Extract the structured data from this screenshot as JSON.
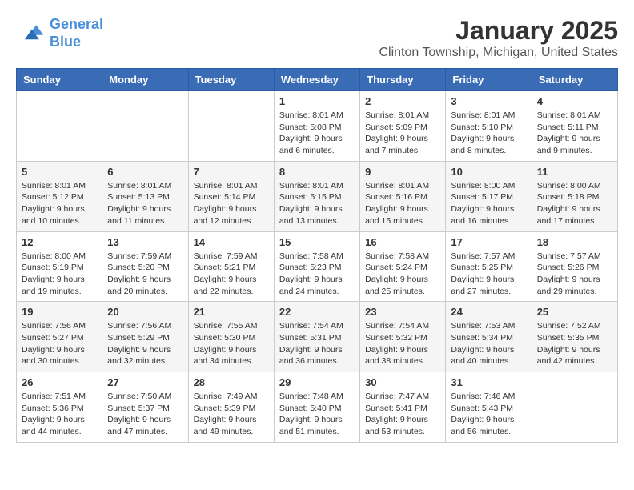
{
  "logo": {
    "line1": "General",
    "line2": "Blue"
  },
  "title": "January 2025",
  "location": "Clinton Township, Michigan, United States",
  "days_of_week": [
    "Sunday",
    "Monday",
    "Tuesday",
    "Wednesday",
    "Thursday",
    "Friday",
    "Saturday"
  ],
  "weeks": [
    [
      {
        "day": "",
        "info": ""
      },
      {
        "day": "",
        "info": ""
      },
      {
        "day": "",
        "info": ""
      },
      {
        "day": "1",
        "info": "Sunrise: 8:01 AM\nSunset: 5:08 PM\nDaylight: 9 hours\nand 6 minutes."
      },
      {
        "day": "2",
        "info": "Sunrise: 8:01 AM\nSunset: 5:09 PM\nDaylight: 9 hours\nand 7 minutes."
      },
      {
        "day": "3",
        "info": "Sunrise: 8:01 AM\nSunset: 5:10 PM\nDaylight: 9 hours\nand 8 minutes."
      },
      {
        "day": "4",
        "info": "Sunrise: 8:01 AM\nSunset: 5:11 PM\nDaylight: 9 hours\nand 9 minutes."
      }
    ],
    [
      {
        "day": "5",
        "info": "Sunrise: 8:01 AM\nSunset: 5:12 PM\nDaylight: 9 hours\nand 10 minutes."
      },
      {
        "day": "6",
        "info": "Sunrise: 8:01 AM\nSunset: 5:13 PM\nDaylight: 9 hours\nand 11 minutes."
      },
      {
        "day": "7",
        "info": "Sunrise: 8:01 AM\nSunset: 5:14 PM\nDaylight: 9 hours\nand 12 minutes."
      },
      {
        "day": "8",
        "info": "Sunrise: 8:01 AM\nSunset: 5:15 PM\nDaylight: 9 hours\nand 13 minutes."
      },
      {
        "day": "9",
        "info": "Sunrise: 8:01 AM\nSunset: 5:16 PM\nDaylight: 9 hours\nand 15 minutes."
      },
      {
        "day": "10",
        "info": "Sunrise: 8:00 AM\nSunset: 5:17 PM\nDaylight: 9 hours\nand 16 minutes."
      },
      {
        "day": "11",
        "info": "Sunrise: 8:00 AM\nSunset: 5:18 PM\nDaylight: 9 hours\nand 17 minutes."
      }
    ],
    [
      {
        "day": "12",
        "info": "Sunrise: 8:00 AM\nSunset: 5:19 PM\nDaylight: 9 hours\nand 19 minutes."
      },
      {
        "day": "13",
        "info": "Sunrise: 7:59 AM\nSunset: 5:20 PM\nDaylight: 9 hours\nand 20 minutes."
      },
      {
        "day": "14",
        "info": "Sunrise: 7:59 AM\nSunset: 5:21 PM\nDaylight: 9 hours\nand 22 minutes."
      },
      {
        "day": "15",
        "info": "Sunrise: 7:58 AM\nSunset: 5:23 PM\nDaylight: 9 hours\nand 24 minutes."
      },
      {
        "day": "16",
        "info": "Sunrise: 7:58 AM\nSunset: 5:24 PM\nDaylight: 9 hours\nand 25 minutes."
      },
      {
        "day": "17",
        "info": "Sunrise: 7:57 AM\nSunset: 5:25 PM\nDaylight: 9 hours\nand 27 minutes."
      },
      {
        "day": "18",
        "info": "Sunrise: 7:57 AM\nSunset: 5:26 PM\nDaylight: 9 hours\nand 29 minutes."
      }
    ],
    [
      {
        "day": "19",
        "info": "Sunrise: 7:56 AM\nSunset: 5:27 PM\nDaylight: 9 hours\nand 30 minutes."
      },
      {
        "day": "20",
        "info": "Sunrise: 7:56 AM\nSunset: 5:29 PM\nDaylight: 9 hours\nand 32 minutes."
      },
      {
        "day": "21",
        "info": "Sunrise: 7:55 AM\nSunset: 5:30 PM\nDaylight: 9 hours\nand 34 minutes."
      },
      {
        "day": "22",
        "info": "Sunrise: 7:54 AM\nSunset: 5:31 PM\nDaylight: 9 hours\nand 36 minutes."
      },
      {
        "day": "23",
        "info": "Sunrise: 7:54 AM\nSunset: 5:32 PM\nDaylight: 9 hours\nand 38 minutes."
      },
      {
        "day": "24",
        "info": "Sunrise: 7:53 AM\nSunset: 5:34 PM\nDaylight: 9 hours\nand 40 minutes."
      },
      {
        "day": "25",
        "info": "Sunrise: 7:52 AM\nSunset: 5:35 PM\nDaylight: 9 hours\nand 42 minutes."
      }
    ],
    [
      {
        "day": "26",
        "info": "Sunrise: 7:51 AM\nSunset: 5:36 PM\nDaylight: 9 hours\nand 44 minutes."
      },
      {
        "day": "27",
        "info": "Sunrise: 7:50 AM\nSunset: 5:37 PM\nDaylight: 9 hours\nand 47 minutes."
      },
      {
        "day": "28",
        "info": "Sunrise: 7:49 AM\nSunset: 5:39 PM\nDaylight: 9 hours\nand 49 minutes."
      },
      {
        "day": "29",
        "info": "Sunrise: 7:48 AM\nSunset: 5:40 PM\nDaylight: 9 hours\nand 51 minutes."
      },
      {
        "day": "30",
        "info": "Sunrise: 7:47 AM\nSunset: 5:41 PM\nDaylight: 9 hours\nand 53 minutes."
      },
      {
        "day": "31",
        "info": "Sunrise: 7:46 AM\nSunset: 5:43 PM\nDaylight: 9 hours\nand 56 minutes."
      },
      {
        "day": "",
        "info": ""
      }
    ]
  ]
}
